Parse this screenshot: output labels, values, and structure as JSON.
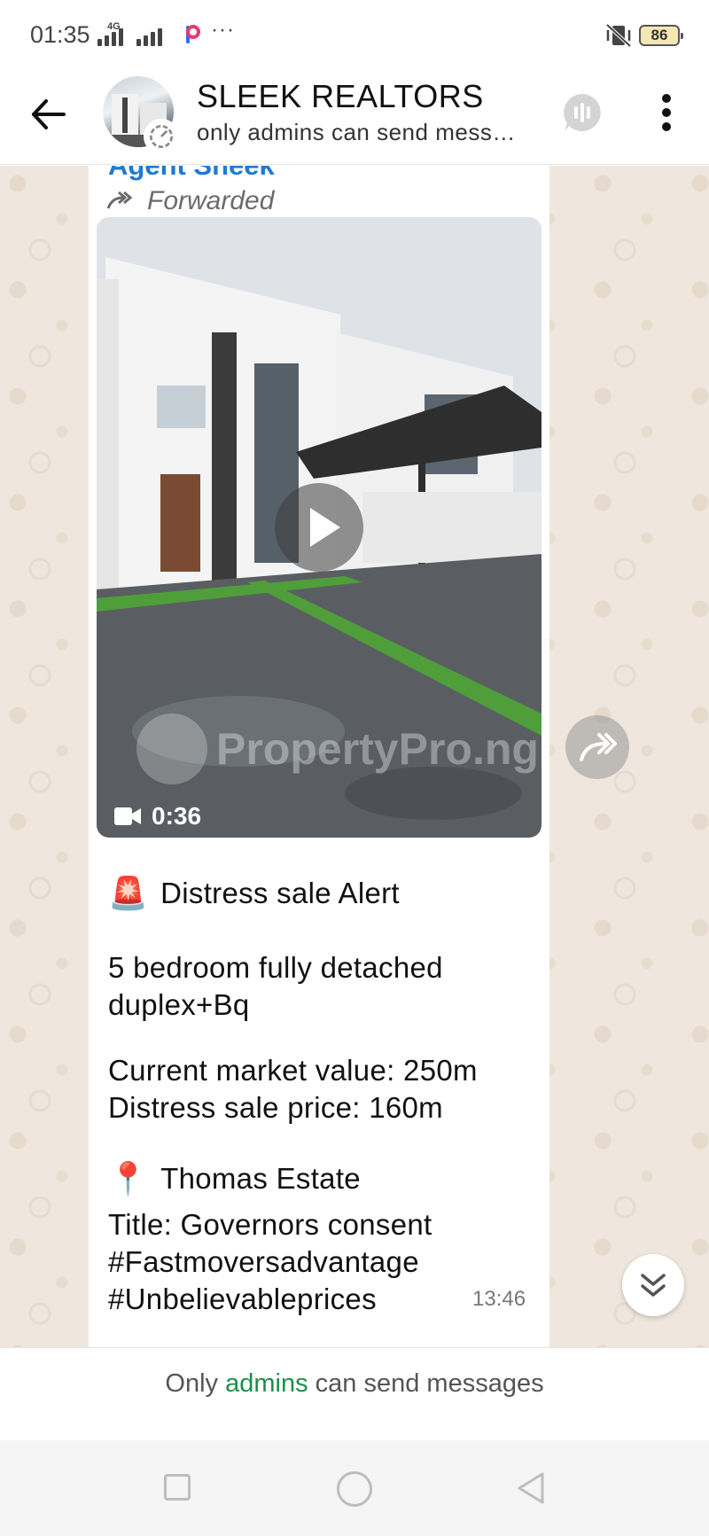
{
  "status_bar": {
    "time": "01:35",
    "network": "4G",
    "more": "···",
    "battery": "86",
    "icons": [
      "signal-icon",
      "app-notification-icon",
      "vibrate-icon",
      "battery-icon"
    ]
  },
  "header": {
    "title": "SLEEK REALTORS",
    "subtitle": "only admins can send mess…",
    "icons": [
      "back-arrow-icon",
      "group-avatar",
      "voice-chat-icon",
      "more-vert-icon"
    ]
  },
  "message": {
    "sender": "Agent Sheek",
    "forwarded_label": "Forwarded",
    "video": {
      "duration": "0:36",
      "watermark": "PropertyPro.ng"
    },
    "alert_line": "Distress sale Alert",
    "alert_emoji": "🚨",
    "description_line1": "5 bedroom fully detached",
    "description_line2": "duplex+Bq",
    "market_value": "Current market value: 250m",
    "sale_price": "Distress sale price: 160m",
    "location_emoji": "📍",
    "location": "Thomas Estate",
    "title_line": "Title: Governors consent",
    "hashtag1": "#Fastmoversadvantage",
    "hashtag2": "#Unbelievableprices",
    "timestamp": "13:46"
  },
  "footer": {
    "prefix": "Only",
    "accent": "admins",
    "suffix": "can send messages"
  },
  "colors": {
    "sender": "#1f7ad2",
    "accent_link": "#1b8f4c",
    "chat_background": "#efe7dd"
  }
}
